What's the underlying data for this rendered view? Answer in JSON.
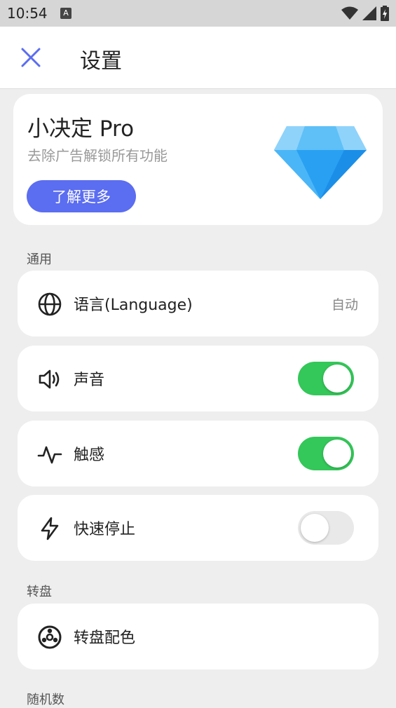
{
  "status": {
    "time": "10:54",
    "badge": "A"
  },
  "appbar": {
    "title": "设置"
  },
  "pro": {
    "title": "小决定 Pro",
    "subtitle": "去除广告解锁所有功能",
    "button": "了解更多"
  },
  "sections": {
    "general": "通用",
    "wheel": "转盘",
    "random": "随机数"
  },
  "rows": {
    "language": {
      "label": "语言(Language)",
      "value": "自动",
      "icon": "globe-icon"
    },
    "sound": {
      "label": "声音",
      "on": true,
      "icon": "speaker-icon"
    },
    "haptic": {
      "label": "触感",
      "on": true,
      "icon": "pulse-icon"
    },
    "quickstop": {
      "label": "快速停止",
      "on": false,
      "icon": "bolt-icon"
    },
    "wheel_colors": {
      "label": "转盘配色",
      "icon": "wheel-icon"
    }
  },
  "colors": {
    "accent": "#5b6df0",
    "toggle_on": "#34c759",
    "toggle_off": "#e9e9ea"
  }
}
